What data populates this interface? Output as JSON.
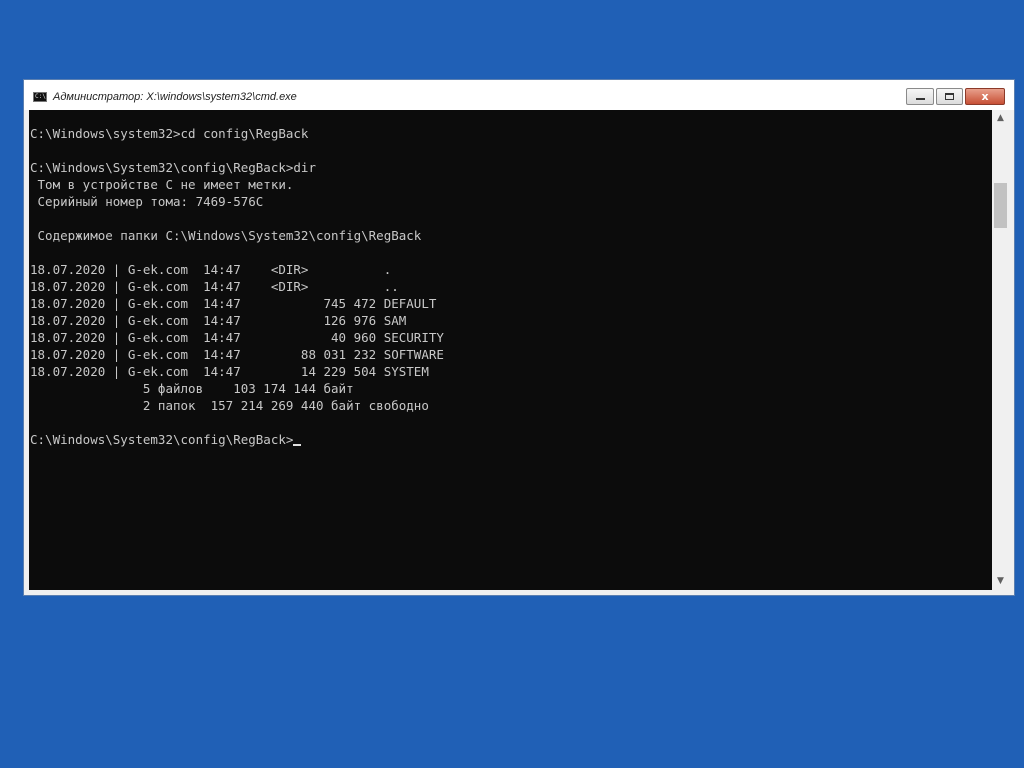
{
  "window": {
    "title": "Администратор: X:\\windows\\system32\\cmd.exe",
    "icon": "cmd-icon",
    "icon_text": "C:\\",
    "controls": {
      "minimize_icon": "minimize-icon",
      "maximize_icon": "maximize-icon",
      "close_icon": "close-icon",
      "close_glyph": "x"
    }
  },
  "console": {
    "lines": [
      "C:\\Windows\\system32>cd config\\RegBack",
      "",
      "C:\\Windows\\System32\\config\\RegBack>dir",
      " Том в устройстве C не имеет метки.",
      " Серийный номер тома: 7469-576C",
      "",
      " Содержимое папки C:\\Windows\\System32\\config\\RegBack",
      "",
      "18.07.2020 | G-ek.com  14:47    <DIR>          .",
      "18.07.2020 | G-ek.com  14:47    <DIR>          ..",
      "18.07.2020 | G-ek.com  14:47           745 472 DEFAULT",
      "18.07.2020 | G-ek.com  14:47           126 976 SAM",
      "18.07.2020 | G-ek.com  14:47            40 960 SECURITY",
      "18.07.2020 | G-ek.com  14:47        88 031 232 SOFTWARE",
      "18.07.2020 | G-ek.com  14:47        14 229 504 SYSTEM",
      "               5 файлов    103 174 144 байт",
      "               2 папок  157 214 269 440 байт свободно",
      ""
    ],
    "prompt": "C:\\Windows\\System32\\config\\RegBack>"
  },
  "scrollbar": {
    "up_icon": "scroll-up-arrow-icon",
    "down_icon": "scroll-down-arrow-icon",
    "up_glyph": "▲",
    "down_glyph": "▼"
  },
  "colors": {
    "desktop_background": "#2060b6",
    "console_background": "#0c0c0c",
    "console_text": "#c8c8c8",
    "close_button": "#c75035"
  }
}
